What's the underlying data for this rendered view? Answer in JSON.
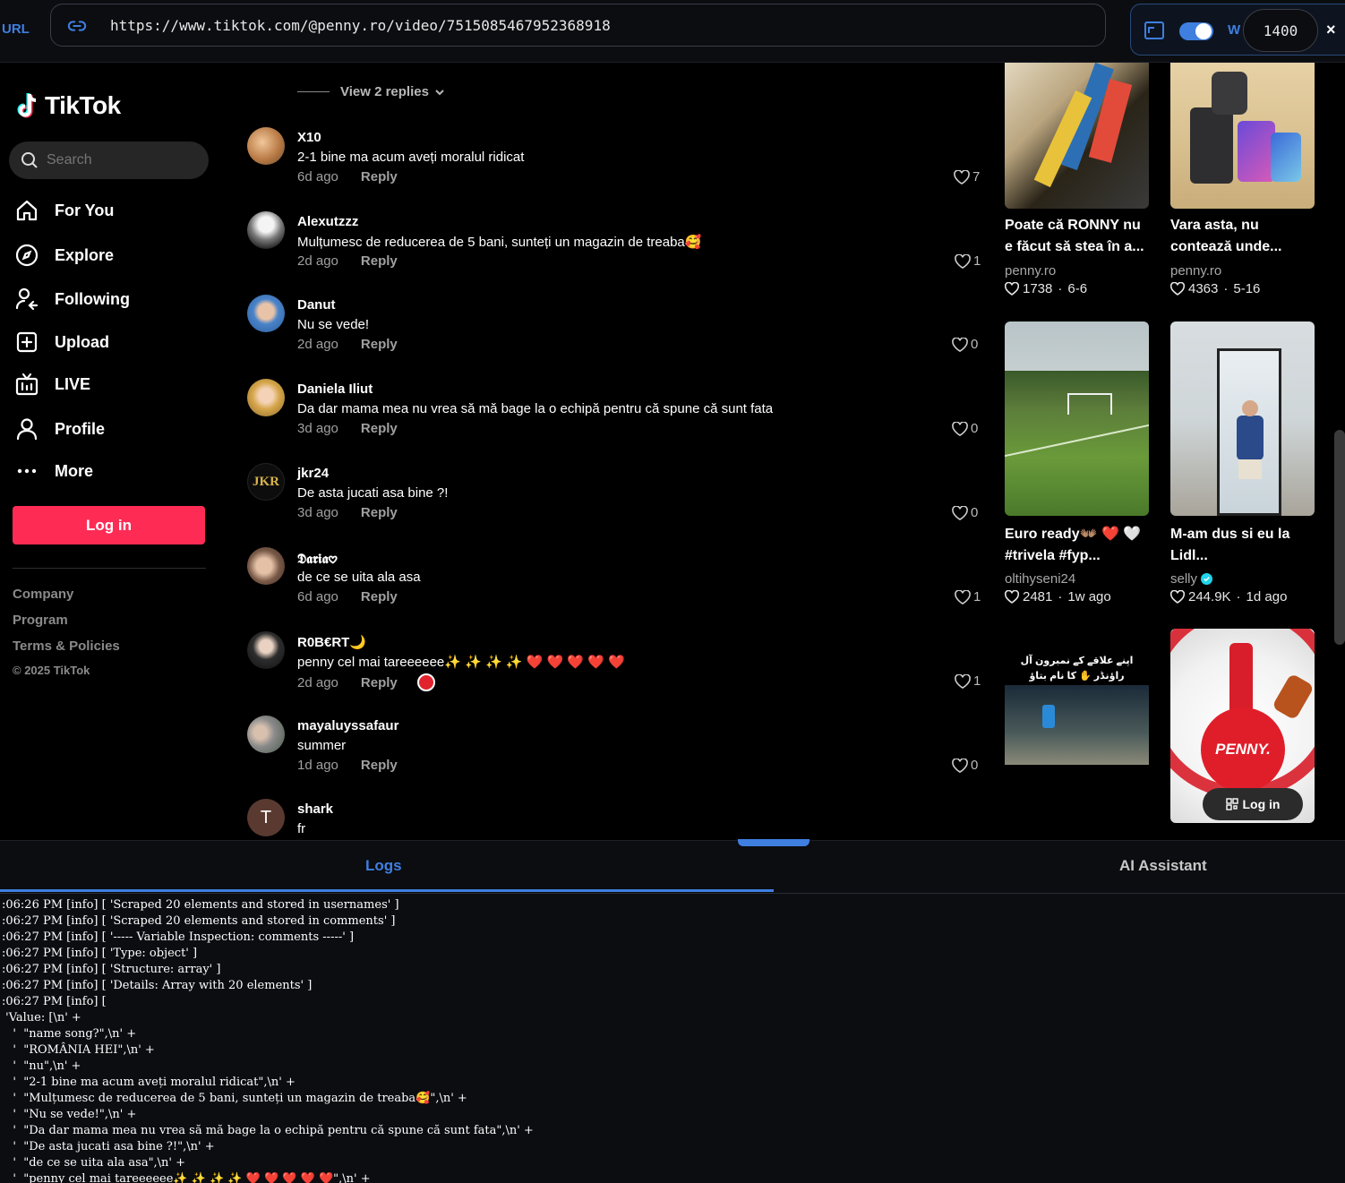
{
  "topbar": {
    "url_label": "URL",
    "url": "https://www.tiktok.com/@penny.ro/video/7515085467952368918",
    "width_label": "W",
    "width_value": "1400",
    "close": "×"
  },
  "nav": {
    "logo_text": "TikTok",
    "search_placeholder": "Search",
    "items": [
      {
        "label": "For You",
        "icon": "home-icon"
      },
      {
        "label": "Explore",
        "icon": "compass-icon"
      },
      {
        "label": "Following",
        "icon": "following-icon"
      },
      {
        "label": "Upload",
        "icon": "upload-icon"
      },
      {
        "label": "LIVE",
        "icon": "live-icon"
      },
      {
        "label": "Profile",
        "icon": "profile-icon"
      },
      {
        "label": "More",
        "icon": "more-icon"
      }
    ],
    "login_label": "Log in",
    "footer": [
      "Company",
      "Program",
      "Terms & Policies"
    ],
    "copyright": "© 2025 TikTok"
  },
  "comments": {
    "view_replies": "View 2 replies",
    "reply_label": "Reply",
    "items": [
      {
        "user": "X10",
        "text": "2-1 bine ma acum aveți moralul ridicat",
        "time": "6d ago",
        "likes": "7"
      },
      {
        "user": "Alexutzzz",
        "text": "Mulțumesc de reducerea de 5 bani, sunteți un magazin de treaba🥰",
        "time": "2d ago",
        "likes": "1"
      },
      {
        "user": "Danut",
        "text": "Nu se vede!",
        "time": "2d ago",
        "likes": "0"
      },
      {
        "user": "Daniela Iliut",
        "text": "Da dar mama mea nu vrea să mă bage la o echipă pentru că spune că sunt fata",
        "time": "3d ago",
        "likes": "0"
      },
      {
        "user": "jkr24",
        "text": "De asta jucati asa bine ?!",
        "time": "3d ago",
        "likes": "0"
      },
      {
        "user": "𝕯𝖆𝖗𝖎𝖆𖹭",
        "text": "de ce se uita ala asa",
        "time": "6d ago",
        "likes": "1"
      },
      {
        "user": "R0B€RT🌙",
        "text": "penny cel mai tareeeeee✨ ✨ ✨ ✨ ❤️ ❤️ ❤️ ❤️ ❤️",
        "time": "2d ago",
        "likes": "1"
      },
      {
        "user": "mayaluyssafaur",
        "text": "summer",
        "time": "1d ago",
        "likes": "0"
      },
      {
        "user": "shark",
        "text": "fr",
        "time": "",
        "likes": ""
      }
    ]
  },
  "recommended": {
    "login_label": "Log in",
    "cards": [
      {
        "title": "Poate că RONNY nu e făcut să stea în a...",
        "author": "penny.ro",
        "likes": "1738",
        "date": "6-6"
      },
      {
        "title": "Vara asta, nu contează unde...",
        "author": "penny.ro",
        "likes": "4363",
        "date": "5-16"
      },
      {
        "title": "Euro ready👐🏽 ❤️ 🤍 #trivela #fyp...",
        "author": "oltihyseni24",
        "likes": "2481",
        "date": "1w ago"
      },
      {
        "title": "M-am dus si eu la Lidl...",
        "author": "selly",
        "likes": "244.9K",
        "date": "1d ago"
      },
      {
        "title": "",
        "author": "",
        "likes": "",
        "date": ""
      },
      {
        "title": "",
        "author": "",
        "likes": "",
        "date": ""
      }
    ],
    "video_caption_3": "اپنے علاقے کے نمبرون آل راؤنڈر ✋ کا نام بتاؤ",
    "penny_brand": "PENNY."
  },
  "panel": {
    "tab_logs": "Logs",
    "tab_ai": "AI Assistant",
    "log_lines": [
      ":06:26 PM [info] [ 'Scraped 20 elements and stored in usernames' ]",
      ":06:27 PM [info] [ 'Scraped 20 elements and stored in comments' ]",
      ":06:27 PM [info] [ '----- Variable Inspection: comments -----' ]",
      ":06:27 PM [info] [ 'Type: object' ]",
      ":06:27 PM [info] [ 'Structure: array' ]",
      ":06:27 PM [info] [ 'Details: Array with 20 elements' ]",
      ":06:27 PM [info] [",
      " 'Value: [\\n' +",
      "   '  \"name song?\",\\n' +",
      "   '  \"ROMÂNIA HEI\",\\n' +",
      "   '  \"nu\",\\n' +",
      "   '  \"2-1 bine ma acum aveți moralul ridicat\",\\n' +",
      "   '  \"Mulțumesc de reducerea de 5 bani, sunteți un magazin de treaba🥰\",\\n' +",
      "   '  \"Nu se vede!\",\\n' +",
      "   '  \"Da dar mama mea nu vrea să mă bage la o echipă pentru că spune că sunt fata\",\\n' +",
      "   '  \"De asta jucati asa bine ?!\",\\n' +",
      "   '  \"de ce se uita ala asa\",\\n' +",
      "   '  \"penny cel mai tareeeeee✨ ✨ ✨ ✨ ❤️ ❤️ ❤️ ❤️ ❤️\",\\n' +"
    ]
  },
  "colors": {
    "accent": "#3f7fe0",
    "tiktok_red": "#fe2c55",
    "background": "#000000"
  }
}
